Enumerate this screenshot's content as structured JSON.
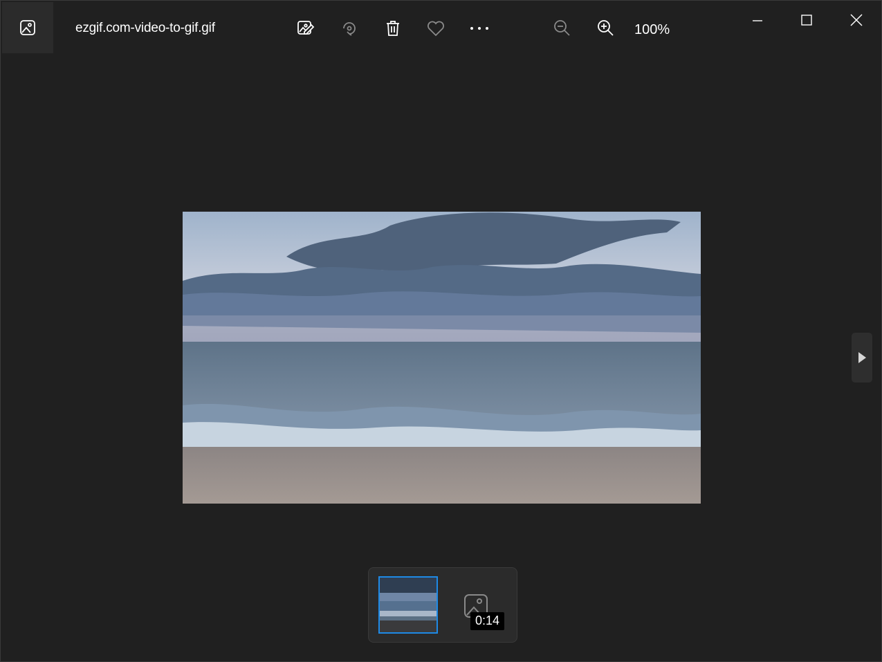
{
  "app": {
    "title": "ezgif.com-video-to-gif.gif",
    "app_icon": "photos-app-icon"
  },
  "toolbar": {
    "buttons": [
      {
        "name": "edit-image-button",
        "icon": "edit-image-icon"
      },
      {
        "name": "rotate-button",
        "icon": "rotate-icon"
      },
      {
        "name": "delete-button",
        "icon": "trash-icon"
      },
      {
        "name": "favorite-button",
        "icon": "heart-icon"
      },
      {
        "name": "more-button",
        "icon": "more-icon"
      },
      {
        "name": "zoom-out-button",
        "icon": "zoom-out-icon"
      },
      {
        "name": "zoom-in-button",
        "icon": "zoom-in-icon"
      }
    ],
    "zoom_level": "100%"
  },
  "window_controls": [
    "minimize",
    "maximize",
    "close"
  ],
  "viewer": {
    "image_description_icon": "beach-photo",
    "next_icon": "play-right-icon"
  },
  "filmstrip": {
    "items": [
      {
        "type": "image",
        "selected": true
      },
      {
        "type": "placeholder",
        "duration": "0:14"
      }
    ]
  },
  "colors": {
    "background": "#202020",
    "accent": "#1e8ae6",
    "text": "#ffffff"
  }
}
